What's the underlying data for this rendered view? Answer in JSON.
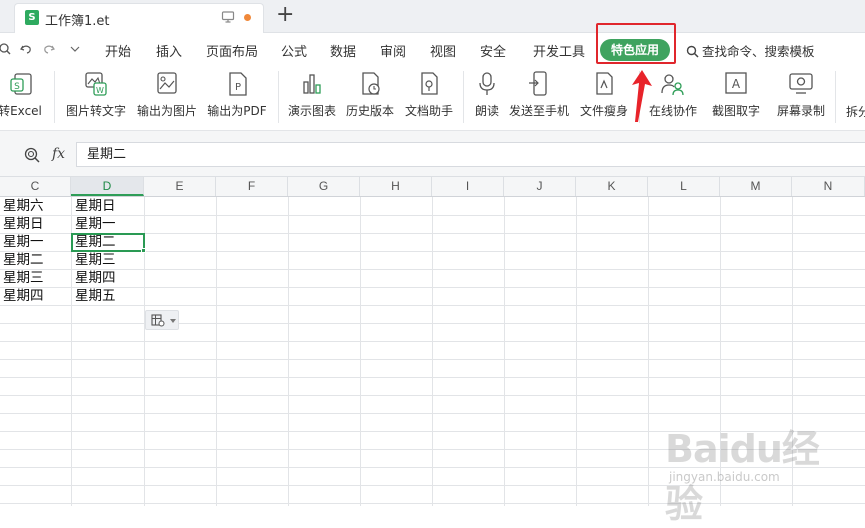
{
  "tab": {
    "title": "工作簿1.et",
    "icon_letter": "S"
  },
  "menu": {
    "items": [
      "开始",
      "插入",
      "页面布局",
      "公式",
      "数据",
      "审阅",
      "视图",
      "安全",
      "开发工具"
    ],
    "active": "特色应用",
    "search": "查找命令、搜索模板"
  },
  "ribbon": {
    "buttons": [
      {
        "label": "转Excel",
        "icon": "convert-excel-icon"
      },
      {
        "label": "图片转文字",
        "icon": "image-to-text-icon"
      },
      {
        "label": "输出为图片",
        "icon": "export-image-icon"
      },
      {
        "label": "输出为PDF",
        "icon": "export-pdf-icon"
      },
      {
        "label": "演示图表",
        "icon": "demo-chart-icon"
      },
      {
        "label": "历史版本",
        "icon": "history-version-icon"
      },
      {
        "label": "文档助手",
        "icon": "document-assistant-icon"
      },
      {
        "label": "朗读",
        "icon": "microphone-icon"
      },
      {
        "label": "发送至手机",
        "icon": "send-to-phone-icon"
      },
      {
        "label": "文件瘦身",
        "icon": "file-slim-icon"
      },
      {
        "label": "在线协作",
        "icon": "online-collab-icon"
      },
      {
        "label": "截图取字",
        "icon": "screenshot-text-icon"
      },
      {
        "label": "屏幕录制",
        "icon": "screen-record-icon"
      },
      {
        "label": "拆分",
        "icon": "split-icon"
      }
    ]
  },
  "formula_bar": {
    "fx": "fx",
    "value": "星期二"
  },
  "grid": {
    "columns": [
      "C",
      "D",
      "E",
      "F",
      "G",
      "H",
      "I",
      "J",
      "K",
      "L",
      "M",
      "N"
    ],
    "active_column": "D",
    "column_c": [
      "星期六",
      "星期日",
      "星期一",
      "星期二",
      "星期三",
      "星期四"
    ],
    "column_d": [
      "星期日",
      "星期一",
      "星期二",
      "星期三",
      "星期四",
      "星期五"
    ],
    "selected_cell": "D3"
  },
  "watermark": {
    "brand": "Baidu经验",
    "url": "jingyan.baidu.com"
  },
  "colors": {
    "accent_green": "#3fa35f",
    "highlight_red": "#e0262c",
    "selection_green": "#2a9a54"
  }
}
